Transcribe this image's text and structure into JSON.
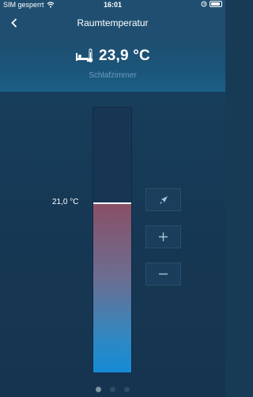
{
  "status": {
    "carrier": "SIM gesperrt",
    "time": "16:01",
    "battery_level": 0.9
  },
  "nav": {
    "title": "Raumtemperatur"
  },
  "header": {
    "temperature": "23,9 °C",
    "room": "Schlafzimmer"
  },
  "setpoint": {
    "label": "21,0 °C",
    "level": 0.64
  },
  "buttons": [
    {
      "name": "boost-button",
      "icon": "rocket-icon"
    },
    {
      "name": "increase-button",
      "icon": "plus-icon"
    },
    {
      "name": "decrease-button",
      "icon": "minus-icon"
    }
  ],
  "pager": {
    "pages": 3,
    "current": 1
  },
  "colors": {
    "accent": "#168ad6",
    "warm": "#8a4f66",
    "background": "#173a55"
  }
}
